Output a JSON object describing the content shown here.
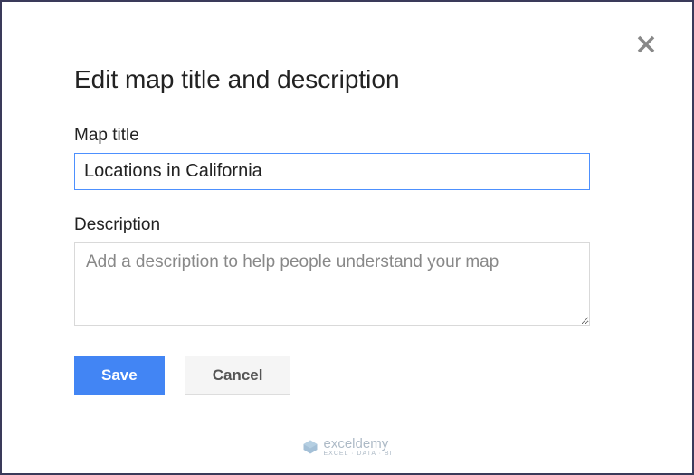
{
  "dialog": {
    "title": "Edit map title and description",
    "map_title_label": "Map title",
    "map_title_value": "Locations in California",
    "description_label": "Description",
    "description_value": "",
    "description_placeholder": "Add a description to help people understand your map",
    "save_label": "Save",
    "cancel_label": "Cancel"
  },
  "watermark": {
    "brand": "exceldemy",
    "sub": "EXCEL · DATA · BI"
  }
}
